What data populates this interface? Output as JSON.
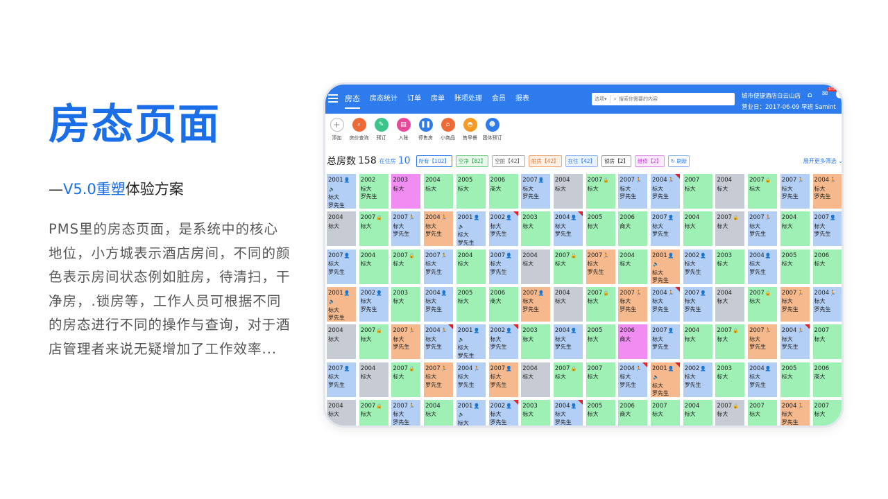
{
  "left": {
    "title": "房态页面",
    "subtitle_dash": "—",
    "subtitle_accent": "V5.0重塑",
    "subtitle_rest": "体验方案",
    "description": "PMS里的房态页面，是系统中的核心地位，小方城表示酒店房间，不同的颜色表示房间状态例如脏房，待清扫，干净房，.锁房等，工作人员可根据不同的房态进行不同的操作与查询，对于酒店管理者来说无疑增加了工作效率..."
  },
  "header": {
    "nav": [
      "房态",
      "房态统计",
      "订单",
      "房单",
      "账项处理",
      "会员",
      "报表"
    ],
    "search_select": "选项",
    "search_placeholder": "搜索你需要的内容",
    "hotel_name": "城市便捷酒店白云山店",
    "business_day": "营业日：2017-06-09 早班 Samint",
    "mail_badge": "10+"
  },
  "toolbar": [
    {
      "label": "添加",
      "icon": "plus-icon",
      "color": "#ffffff",
      "glyph": "+"
    },
    {
      "label": "房价查询",
      "icon": "price-query-icon",
      "color": "#f06a35",
      "glyph": "⌕"
    },
    {
      "label": "预订",
      "icon": "booking-icon",
      "color": "#3cc48a",
      "glyph": "✎"
    },
    {
      "label": "入账",
      "icon": "posting-icon",
      "color": "#e8489a",
      "glyph": "▤"
    },
    {
      "label": "停售房",
      "icon": "stop-sale-icon",
      "color": "#2d7bec",
      "glyph": "❚❚"
    },
    {
      "label": "小商品",
      "icon": "shop-icon",
      "color": "#f06a35",
      "glyph": "⌂"
    },
    {
      "label": "售早餐",
      "icon": "breakfast-icon",
      "color": "#f59a23",
      "glyph": "◓"
    },
    {
      "label": "团体预订",
      "icon": "group-booking-icon",
      "color": "#2d7bec",
      "glyph": "☻"
    }
  ],
  "filters": {
    "total_label": "总房数",
    "total_value": "158",
    "occupied_label": "在住房",
    "occupied_value": "10",
    "chips": {
      "all": "所有【102】",
      "clean": "空净【82】",
      "vacant_dirty": "空脏【42】",
      "dirty": "脏房【42】",
      "occupied": "在住【42】",
      "locked": "锁房【2】",
      "repair": "维修【2】",
      "refresh": "刷新"
    },
    "more": "展开更多筛选"
  },
  "room_type_normal": "标大",
  "room_type_business": "商大",
  "guest_name": "罗先生",
  "colors": {
    "blue": "#b3cff5",
    "green": "#9ef0b5",
    "gray": "#c7ccd4",
    "orange": "#f5b98d",
    "pink": "#f08cf2",
    "corner": "#e02222"
  },
  "rooms": [
    [
      {
        "n": "2001",
        "c": "blue",
        "t": "标大",
        "g": "罗先生",
        "i": "user-speaker",
        "k": false
      },
      {
        "n": "2002",
        "c": "green",
        "t": "标大",
        "g": "罗先生",
        "i": "",
        "k": false
      },
      {
        "n": "2003",
        "c": "pink",
        "t": "标大",
        "g": "",
        "i": "",
        "k": false
      },
      {
        "n": "2004",
        "c": "green",
        "t": "标大",
        "g": "",
        "i": "",
        "k": false
      },
      {
        "n": "2005",
        "c": "green",
        "t": "标大",
        "g": "",
        "i": "",
        "k": false
      },
      {
        "n": "2006",
        "c": "green",
        "t": "商大",
        "g": "",
        "i": "",
        "k": false
      },
      {
        "n": "2007",
        "c": "blue",
        "t": "标大",
        "g": "罗先生",
        "i": "user",
        "k": false
      },
      {
        "n": "2004",
        "c": "gray",
        "t": "标大",
        "g": "",
        "i": "",
        "k": false
      },
      {
        "n": "2007",
        "c": "green",
        "t": "标大",
        "g": "",
        "i": "lock",
        "k": false
      },
      {
        "n": "2007",
        "c": "blue",
        "t": "标大",
        "g": "罗先生",
        "i": "run",
        "k": false
      },
      {
        "n": "2004",
        "c": "blue",
        "t": "标大",
        "g": "罗先生",
        "i": "run",
        "k": true
      },
      {
        "n": "2007",
        "c": "green",
        "t": "标大",
        "g": "",
        "i": "",
        "k": false
      },
      {
        "n": "2004",
        "c": "gray",
        "t": "标大",
        "g": "",
        "i": "",
        "k": false
      },
      {
        "n": "2007",
        "c": "green",
        "t": "标大",
        "g": "",
        "i": "lock",
        "k": false
      },
      {
        "n": "2007",
        "c": "blue",
        "t": "标大",
        "g": "罗先生",
        "i": "run",
        "k": false
      },
      {
        "n": "2004",
        "c": "orange",
        "t": "标大",
        "g": "罗先生",
        "i": "run-o",
        "k": false
      }
    ],
    [
      {
        "n": "2004",
        "c": "gray",
        "t": "标大",
        "g": "",
        "i": "",
        "k": false
      },
      {
        "n": "2007",
        "c": "green",
        "t": "标大",
        "g": "",
        "i": "lock",
        "k": false
      },
      {
        "n": "2007",
        "c": "blue",
        "t": "标大",
        "g": "罗先生",
        "i": "run",
        "k": false
      },
      {
        "n": "2004",
        "c": "orange",
        "t": "标大",
        "g": "罗先生",
        "i": "run-o",
        "k": false
      },
      {
        "n": "2001",
        "c": "blue",
        "t": "标大",
        "g": "罗先生",
        "i": "user-speaker",
        "k": false
      },
      {
        "n": "2002",
        "c": "blue",
        "t": "标大",
        "g": "罗先生",
        "i": "user",
        "k": true
      },
      {
        "n": "2003",
        "c": "green",
        "t": "标大",
        "g": "",
        "i": "",
        "k": false
      },
      {
        "n": "2004",
        "c": "blue",
        "t": "标大",
        "g": "罗先生",
        "i": "user",
        "k": true
      },
      {
        "n": "2005",
        "c": "green",
        "t": "标大",
        "g": "",
        "i": "",
        "k": false
      },
      {
        "n": "2006",
        "c": "green",
        "t": "商大",
        "g": "",
        "i": "",
        "k": false
      },
      {
        "n": "2007",
        "c": "blue",
        "t": "标大",
        "g": "罗先生",
        "i": "user",
        "k": false
      },
      {
        "n": "2004",
        "c": "green",
        "t": "标大",
        "g": "",
        "i": "",
        "k": false
      },
      {
        "n": "2007",
        "c": "gray",
        "t": "标大",
        "g": "",
        "i": "lock",
        "k": false
      },
      {
        "n": "2007",
        "c": "blue",
        "t": "标大",
        "g": "罗先生",
        "i": "run",
        "k": false
      },
      {
        "n": "2004",
        "c": "green",
        "t": "标大",
        "g": "",
        "i": "",
        "k": false
      },
      {
        "n": "2007",
        "c": "blue",
        "t": "标大",
        "g": "罗先生",
        "i": "user",
        "k": false
      }
    ],
    [
      {
        "n": "2007",
        "c": "blue",
        "t": "标大",
        "g": "罗先生",
        "i": "user",
        "k": false
      },
      {
        "n": "2004",
        "c": "green",
        "t": "标大",
        "g": "",
        "i": "",
        "k": false
      },
      {
        "n": "2007",
        "c": "green",
        "t": "标大",
        "g": "",
        "i": "lock",
        "k": false
      },
      {
        "n": "2007",
        "c": "blue",
        "t": "标大",
        "g": "罗先生",
        "i": "run",
        "k": false
      },
      {
        "n": "2004",
        "c": "green",
        "t": "标大",
        "g": "",
        "i": "",
        "k": false
      },
      {
        "n": "2007",
        "c": "blue",
        "t": "标大",
        "g": "罗先生",
        "i": "user",
        "k": false
      },
      {
        "n": "2004",
        "c": "gray",
        "t": "标大",
        "g": "",
        "i": "",
        "k": false
      },
      {
        "n": "2007",
        "c": "green",
        "t": "标大",
        "g": "",
        "i": "lock",
        "k": false
      },
      {
        "n": "2007",
        "c": "orange",
        "t": "标大",
        "g": "罗先生",
        "i": "run-o",
        "k": false
      },
      {
        "n": "2004",
        "c": "green",
        "t": "标大",
        "g": "",
        "i": "",
        "k": false
      },
      {
        "n": "2001",
        "c": "orange",
        "t": "标大",
        "g": "罗先生",
        "i": "user-speaker-o",
        "k": false
      },
      {
        "n": "2002",
        "c": "blue",
        "t": "标大",
        "g": "罗先生",
        "i": "user",
        "k": false
      },
      {
        "n": "2003",
        "c": "green",
        "t": "标大",
        "g": "",
        "i": "",
        "k": false
      },
      {
        "n": "2004",
        "c": "blue",
        "t": "标大",
        "g": "罗先生",
        "i": "user",
        "k": false
      },
      {
        "n": "2005",
        "c": "green",
        "t": "标大",
        "g": "",
        "i": "",
        "k": false
      },
      {
        "n": "2006",
        "c": "green",
        "t": "标大",
        "g": "",
        "i": "",
        "k": false
      }
    ],
    [
      {
        "n": "2001",
        "c": "orange",
        "t": "标大",
        "g": "罗先生",
        "i": "user-speaker-o",
        "k": false
      },
      {
        "n": "2002",
        "c": "blue",
        "t": "标大",
        "g": "罗先生",
        "i": "user",
        "k": false
      },
      {
        "n": "2003",
        "c": "green",
        "t": "标大",
        "g": "",
        "i": "",
        "k": false
      },
      {
        "n": "2004",
        "c": "blue",
        "t": "标大",
        "g": "罗先生",
        "i": "user",
        "k": false
      },
      {
        "n": "2005",
        "c": "green",
        "t": "标大",
        "g": "",
        "i": "",
        "k": false
      },
      {
        "n": "2006",
        "c": "green",
        "t": "商大",
        "g": "",
        "i": "",
        "k": false
      },
      {
        "n": "2007",
        "c": "orange",
        "t": "标大",
        "g": "罗先生",
        "i": "user-o",
        "k": false
      },
      {
        "n": "2004",
        "c": "gray",
        "t": "标大",
        "g": "",
        "i": "",
        "k": false
      },
      {
        "n": "2007",
        "c": "green",
        "t": "标大",
        "g": "",
        "i": "lock",
        "k": false
      },
      {
        "n": "2007",
        "c": "orange",
        "t": "标大",
        "g": "罗先生",
        "i": "run-o",
        "k": false
      },
      {
        "n": "2004",
        "c": "blue",
        "t": "标大",
        "g": "罗先生",
        "i": "run",
        "k": true
      },
      {
        "n": "2007",
        "c": "blue",
        "t": "标大",
        "g": "罗先生",
        "i": "user",
        "k": false
      },
      {
        "n": "2004",
        "c": "gray",
        "t": "标大",
        "g": "",
        "i": "",
        "k": false
      },
      {
        "n": "2007",
        "c": "green",
        "t": "标大",
        "g": "",
        "i": "lock",
        "k": false
      },
      {
        "n": "2007",
        "c": "orange",
        "t": "标大",
        "g": "罗先生",
        "i": "run-o",
        "k": false
      },
      {
        "n": "2004",
        "c": "blue",
        "t": "标大",
        "g": "罗先生",
        "i": "run",
        "k": false
      }
    ],
    [
      {
        "n": "2004",
        "c": "gray",
        "t": "标大",
        "g": "",
        "i": "",
        "k": false
      },
      {
        "n": "2007",
        "c": "green",
        "t": "标大",
        "g": "",
        "i": "lock",
        "k": false
      },
      {
        "n": "2007",
        "c": "orange",
        "t": "标大",
        "g": "罗先生",
        "i": "run-o",
        "k": false
      },
      {
        "n": "2004",
        "c": "blue",
        "t": "标大",
        "g": "罗先生",
        "i": "run",
        "k": true
      },
      {
        "n": "2001",
        "c": "blue",
        "t": "标大",
        "g": "罗先生",
        "i": "user-speaker",
        "k": false
      },
      {
        "n": "2002",
        "c": "blue",
        "t": "标大",
        "g": "罗先生",
        "i": "user",
        "k": true
      },
      {
        "n": "2003",
        "c": "green",
        "t": "标大",
        "g": "",
        "i": "",
        "k": false
      },
      {
        "n": "2004",
        "c": "blue",
        "t": "标大",
        "g": "罗先生",
        "i": "user",
        "k": false
      },
      {
        "n": "2005",
        "c": "green",
        "t": "标大",
        "g": "",
        "i": "",
        "k": false
      },
      {
        "n": "2006",
        "c": "pink",
        "t": "商大",
        "g": "",
        "i": "",
        "k": false
      },
      {
        "n": "2007",
        "c": "blue",
        "t": "标大",
        "g": "罗先生",
        "i": "user",
        "k": false
      },
      {
        "n": "2004",
        "c": "green",
        "t": "标大",
        "g": "",
        "i": "",
        "k": false
      },
      {
        "n": "2007",
        "c": "green",
        "t": "标大",
        "g": "",
        "i": "lock",
        "k": false
      },
      {
        "n": "2007",
        "c": "orange",
        "t": "标大",
        "g": "罗先生",
        "i": "run-o",
        "k": false
      },
      {
        "n": "2004",
        "c": "blue",
        "t": "标大",
        "g": "罗先生",
        "i": "run",
        "k": true
      },
      {
        "n": "2007",
        "c": "green",
        "t": "标大",
        "g": "",
        "i": "",
        "k": false
      }
    ],
    [
      {
        "n": "2007",
        "c": "blue",
        "t": "标大",
        "g": "罗先生",
        "i": "user",
        "k": false
      },
      {
        "n": "2004",
        "c": "gray",
        "t": "标大",
        "g": "",
        "i": "",
        "k": false
      },
      {
        "n": "2007",
        "c": "green",
        "t": "标大",
        "g": "",
        "i": "lock",
        "k": false
      },
      {
        "n": "2007",
        "c": "orange",
        "t": "标大",
        "g": "罗先生",
        "i": "run-o",
        "k": false
      },
      {
        "n": "2004",
        "c": "blue",
        "t": "标大",
        "g": "罗先生",
        "i": "run",
        "k": false
      },
      {
        "n": "2007",
        "c": "orange",
        "t": "标大",
        "g": "罗先生",
        "i": "user-o",
        "k": false
      },
      {
        "n": "2004",
        "c": "gray",
        "t": "标大",
        "g": "",
        "i": "",
        "k": false
      },
      {
        "n": "2007",
        "c": "green",
        "t": "标大",
        "g": "",
        "i": "lock",
        "k": false
      },
      {
        "n": "2007",
        "c": "green",
        "t": "标大",
        "g": "",
        "i": "",
        "k": false
      },
      {
        "n": "2004",
        "c": "blue",
        "t": "标大",
        "g": "罗先生",
        "i": "run",
        "k": true
      },
      {
        "n": "2001",
        "c": "orange",
        "t": "标大",
        "g": "罗先生",
        "i": "user-speaker-o",
        "k": true
      },
      {
        "n": "2002",
        "c": "blue",
        "t": "标大",
        "g": "罗先生",
        "i": "user",
        "k": false
      },
      {
        "n": "2003",
        "c": "green",
        "t": "标大",
        "g": "",
        "i": "",
        "k": false
      },
      {
        "n": "2004",
        "c": "blue",
        "t": "标大",
        "g": "罗先生",
        "i": "user",
        "k": false
      },
      {
        "n": "2005",
        "c": "green",
        "t": "标大",
        "g": "",
        "i": "",
        "k": false
      },
      {
        "n": "2006",
        "c": "green",
        "t": "商大",
        "g": "",
        "i": "",
        "k": false
      }
    ],
    [
      {
        "n": "2004",
        "c": "gray",
        "t": "标大",
        "g": "",
        "i": "",
        "k": false
      },
      {
        "n": "2007",
        "c": "green",
        "t": "标大",
        "g": "",
        "i": "lock",
        "k": false
      },
      {
        "n": "2007",
        "c": "blue",
        "t": "标大",
        "g": "罗先生",
        "i": "run",
        "k": false
      },
      {
        "n": "2004",
        "c": "green",
        "t": "标大",
        "g": "",
        "i": "",
        "k": false
      },
      {
        "n": "2001",
        "c": "blue",
        "t": "标大",
        "g": "罗先生",
        "i": "user-speaker",
        "k": false
      },
      {
        "n": "2002",
        "c": "blue",
        "t": "标大",
        "g": "罗先生",
        "i": "user",
        "k": true
      },
      {
        "n": "2003",
        "c": "green",
        "t": "标大",
        "g": "",
        "i": "",
        "k": false
      },
      {
        "n": "2004",
        "c": "blue",
        "t": "标大",
        "g": "罗先生",
        "i": "user",
        "k": true
      },
      {
        "n": "2005",
        "c": "green",
        "t": "标大",
        "g": "",
        "i": "",
        "k": false
      },
      {
        "n": "2006",
        "c": "green",
        "t": "商大",
        "g": "",
        "i": "",
        "k": false
      },
      {
        "n": "2007",
        "c": "green",
        "t": "标大",
        "g": "",
        "i": "",
        "k": false
      },
      {
        "n": "2004",
        "c": "green",
        "t": "标大",
        "g": "",
        "i": "",
        "k": false
      },
      {
        "n": "2007",
        "c": "gray",
        "t": "标大",
        "g": "",
        "i": "lock",
        "k": false
      },
      {
        "n": "2007",
        "c": "green",
        "t": "标大",
        "g": "",
        "i": "",
        "k": false
      },
      {
        "n": "2004",
        "c": "orange",
        "t": "标大",
        "g": "罗先生",
        "i": "run-o",
        "k": false
      },
      {
        "n": "2007",
        "c": "green",
        "t": "标大",
        "g": "",
        "i": "",
        "k": false
      }
    ]
  ]
}
